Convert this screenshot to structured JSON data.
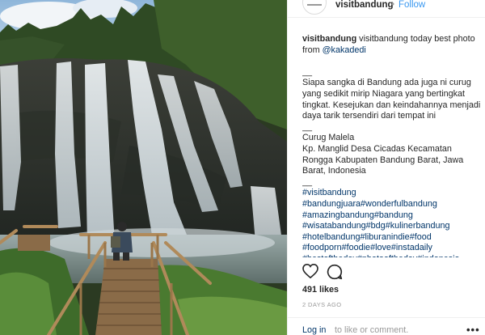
{
  "post": {
    "username": "visitbandung",
    "separator": "•",
    "follow_label": "Follow",
    "caption": {
      "username": "visitbandung",
      "text_intro": " visitbandung today best photo from ",
      "mention": "@kakadedi",
      "divider1": "__",
      "paragraph": "Siapa sangka di Bandung ada juga ni curug yang sedikit mirip Niagara yang bertingkat tingkat. Kesejukan dan keindahannya menjadi daya tarik tersendiri dari tempat ini",
      "divider2": "__",
      "location": "Curug Malela",
      "address": "Kp. Manglid Desa Cicadas Kecamatan Rongga Kabupaten Bandung Barat, Jawa Barat, Indonesia",
      "divider3": "__",
      "hashtag_lines": [
        [
          "#visitbandung"
        ],
        [
          "#bandungjuara",
          "#wonderfulbandung"
        ],
        [
          "#amazingbandung",
          "#bandung"
        ],
        [
          "#wisatabandung",
          "#bdg",
          "#kulinerbandung"
        ],
        [
          "#hotelbandung",
          "#liburanindie",
          "#food"
        ],
        [
          "#foodporn",
          "#foodie",
          "#love",
          "#instadaily"
        ],
        [
          "#bestoftheday",
          "#photooftheday",
          "#indonesia"
        ]
      ]
    },
    "likes": "491 likes",
    "time_ago": "2 DAYS AGO",
    "comment": {
      "login_label": "Log in",
      "rest": " to like or comment.",
      "more_label": "•••"
    },
    "icons": {
      "like": "heart-outline-icon",
      "comment": "comment-bubble-icon",
      "more": "more-options-icon"
    }
  }
}
